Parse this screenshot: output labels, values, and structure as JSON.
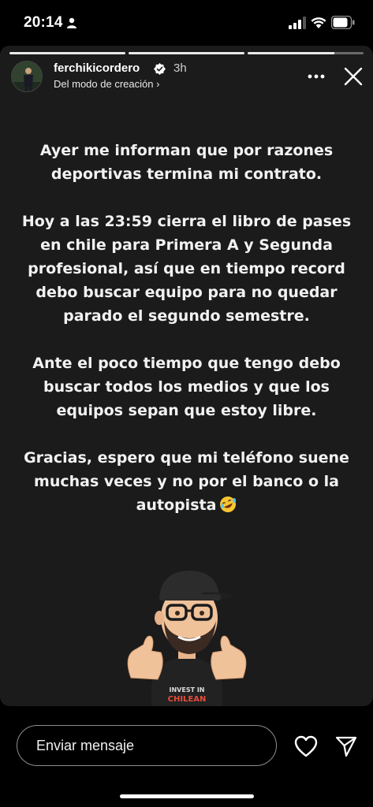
{
  "status_bar": {
    "time": "20:14"
  },
  "story": {
    "progress": [
      1,
      1,
      0.75
    ],
    "user_name": "ferchikicordero",
    "time_ago": "3h",
    "subtitle": "Del modo de creación ›",
    "paragraphs": [
      "Ayer me informan que por razones deportivas termina mi contrato.",
      "Hoy a las 23:59 cierra el libro de pases en chile para Primera A y Segunda profesional, así que en tiempo record debo buscar equipo para no quedar parado el segundo semestre.",
      "Ante el poco tiempo que tengo debo buscar todos los medios y que los equipos sepan que estoy libre.",
      "Gracias, espero que mi teléfono suene muchas veces y no por el banco o la autopista"
    ],
    "emoji": "rolling-on-floor-laughing",
    "sticker": {
      "shirt_line1": "INVEST IN",
      "shirt_line2": "CHILEAN"
    }
  },
  "reply": {
    "placeholder": "Enviar mensaje"
  },
  "colors": {
    "story_bg": "#1b1b1b",
    "page_bg": "#000000",
    "text": "#f2f2f2",
    "verified": "#3897f0"
  }
}
